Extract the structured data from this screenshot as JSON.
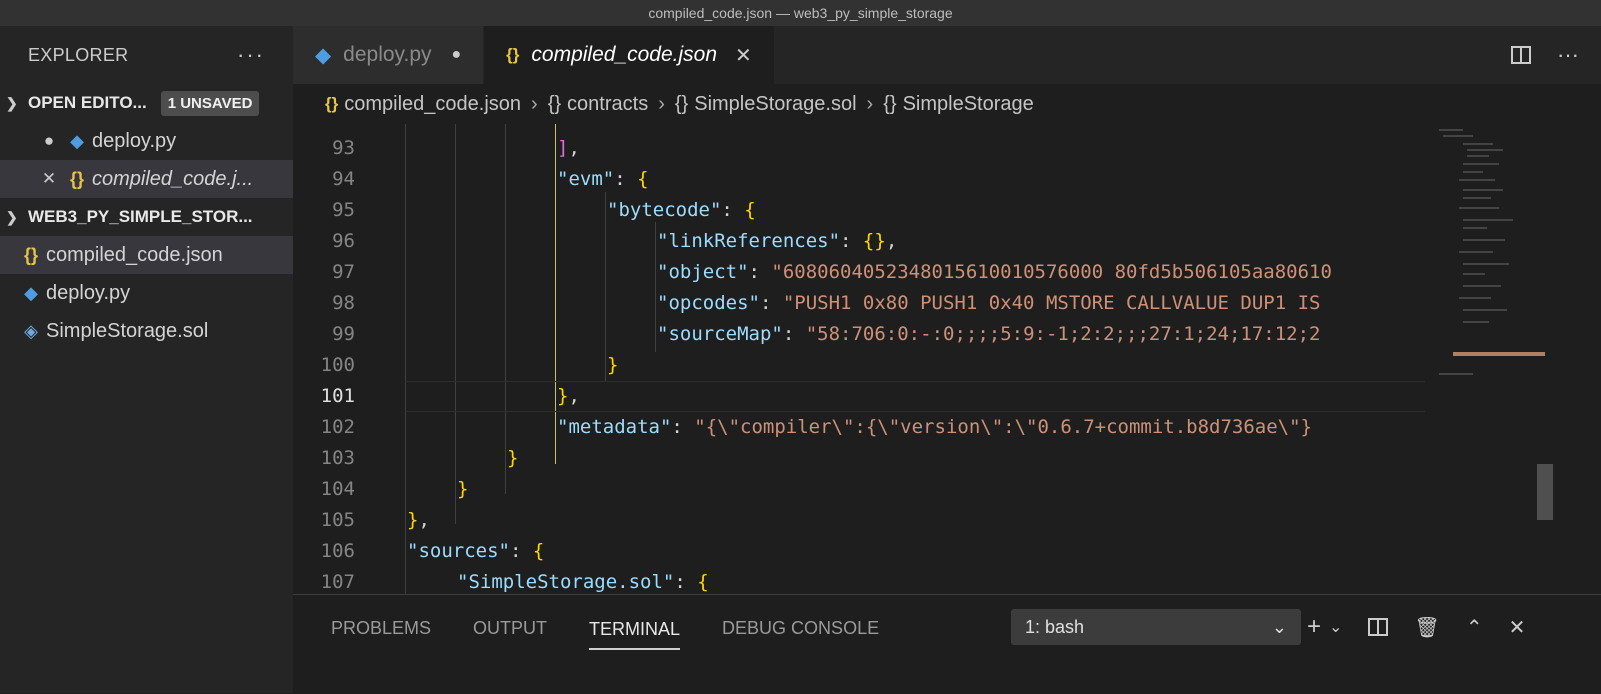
{
  "window": {
    "title": "compiled_code.json — web3_py_simple_storage"
  },
  "sidebar": {
    "title": "EXPLORER",
    "more_label": "···",
    "open_editors": {
      "label": "OPEN EDITO...",
      "badge": "1 UNSAVED",
      "items": [
        {
          "name": "deploy.py",
          "lead": "●",
          "icon": "python-icon"
        },
        {
          "name": "compiled_code.j...",
          "lead": "✕",
          "icon": "json-icon"
        }
      ]
    },
    "project": {
      "label": "WEB3_PY_SIMPLE_STOR...",
      "items": [
        {
          "name": "compiled_code.json",
          "icon": "json-icon"
        },
        {
          "name": "deploy.py",
          "icon": "python-icon"
        },
        {
          "name": "SimpleStorage.sol",
          "icon": "solidity-icon"
        }
      ]
    }
  },
  "tabs": [
    {
      "label": "deploy.py",
      "state": "unsaved"
    },
    {
      "label": "compiled_code.json",
      "state": "active"
    }
  ],
  "breadcrumb": [
    "compiled_code.json",
    "contracts",
    "SimpleStorage.sol",
    "SimpleStorage"
  ],
  "editor": {
    "current_line": 101,
    "lines": [
      {
        "n": "93",
        "text": "],",
        "indent": 4
      },
      {
        "n": "94",
        "text": "\"evm\": {",
        "indent": 4
      },
      {
        "n": "95",
        "text": "\"bytecode\": {",
        "indent": 5
      },
      {
        "n": "96",
        "text": "\"linkReferences\": {},",
        "indent": 6
      },
      {
        "n": "97",
        "text": "\"object\": \"6080604052348015610010576000 80fd5b506105aa80610",
        "indent": 6
      },
      {
        "n": "98",
        "text": "\"opcodes\": \"PUSH1 0x80 PUSH1 0x40 MSTORE CALLVALUE DUP1 IS",
        "indent": 6
      },
      {
        "n": "99",
        "text": "\"sourceMap\": \"58:706:0:-:0;;;;5:9:-1;2:2;;;27:1;24;17:12;2",
        "indent": 6
      },
      {
        "n": "100",
        "text": "}",
        "indent": 5
      },
      {
        "n": "101",
        "text": "},",
        "indent": 4
      },
      {
        "n": "102",
        "text": "\"metadata\": \"{\\\"compiler\\\":{\\\"version\\\":\\\"0.6.7+commit.b8d736ae\\\"}",
        "indent": 4
      },
      {
        "n": "103",
        "text": "}",
        "indent": 3
      },
      {
        "n": "104",
        "text": "}",
        "indent": 2
      },
      {
        "n": "105",
        "text": "},",
        "indent": 1
      },
      {
        "n": "106",
        "text": "\"sources\": {",
        "indent": 1
      },
      {
        "n": "107",
        "text": "\"SimpleStorage.sol\": {",
        "indent": 2
      }
    ]
  },
  "panel": {
    "tabs": [
      "PROBLEMS",
      "OUTPUT",
      "TERMINAL",
      "DEBUG CONSOLE"
    ],
    "active_tab": "TERMINAL",
    "terminal_select": "1: bash"
  }
}
